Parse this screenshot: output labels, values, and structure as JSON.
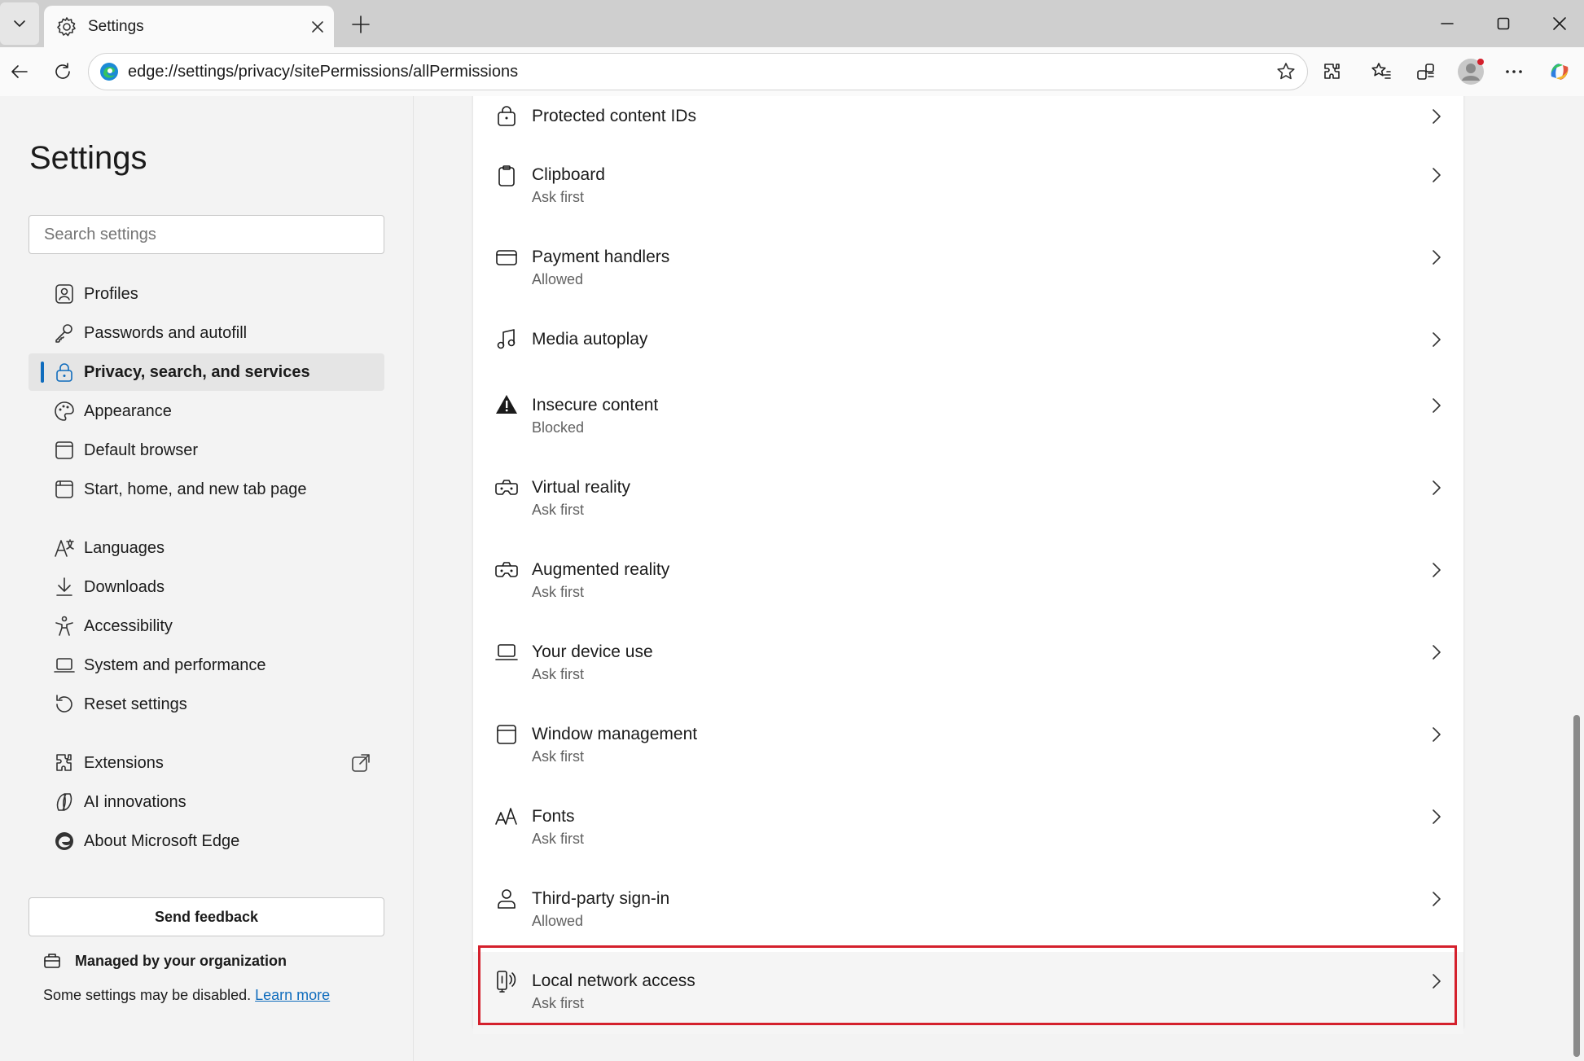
{
  "tab": {
    "title": "Settings"
  },
  "address": {
    "url": "edge://settings/privacy/sitePermissions/allPermissions"
  },
  "sidebar": {
    "title": "Settings",
    "search_placeholder": "Search settings",
    "items": [
      {
        "label": "Profiles",
        "icon": "profile-icon"
      },
      {
        "label": "Passwords and autofill",
        "icon": "key-icon"
      },
      {
        "label": "Privacy, search, and services",
        "icon": "lock-icon",
        "selected": true
      },
      {
        "label": "Appearance",
        "icon": "palette-icon"
      },
      {
        "label": "Default browser",
        "icon": "browser-icon"
      },
      {
        "label": "Start, home, and new tab page",
        "icon": "home-page-icon"
      },
      {
        "label": "Languages",
        "icon": "languages-icon"
      },
      {
        "label": "Downloads",
        "icon": "download-icon"
      },
      {
        "label": "Accessibility",
        "icon": "accessibility-icon"
      },
      {
        "label": "System and performance",
        "icon": "laptop-icon"
      },
      {
        "label": "Reset settings",
        "icon": "reset-icon"
      },
      {
        "label": "Extensions",
        "icon": "extensions-icon"
      },
      {
        "label": "AI innovations",
        "icon": "ai-innovations-icon"
      },
      {
        "label": "About Microsoft Edge",
        "icon": "edge-logo-icon"
      }
    ],
    "feedback_label": "Send feedback",
    "managed_label": "Managed by your organization",
    "managed_sub": "Some settings may be disabled. ",
    "learn_more": "Learn more"
  },
  "permissions": [
    {
      "label": "Protected content IDs",
      "sub": "",
      "icon": "protected-content-icon"
    },
    {
      "label": "Clipboard",
      "sub": "Ask first",
      "icon": "clipboard-icon"
    },
    {
      "label": "Payment handlers",
      "sub": "Allowed",
      "icon": "payment-card-icon"
    },
    {
      "label": "Media autoplay",
      "sub": "",
      "icon": "music-note-icon"
    },
    {
      "label": "Insecure content",
      "sub": "Blocked",
      "icon": "warning-icon"
    },
    {
      "label": "Virtual reality",
      "sub": "Ask first",
      "icon": "vr-headset-icon"
    },
    {
      "label": "Augmented reality",
      "sub": "Ask first",
      "icon": "ar-headset-icon"
    },
    {
      "label": "Your device use",
      "sub": "Ask first",
      "icon": "laptop-icon"
    },
    {
      "label": "Window management",
      "sub": "Ask first",
      "icon": "window-icon"
    },
    {
      "label": "Fonts",
      "sub": "Ask first",
      "icon": "fonts-icon"
    },
    {
      "label": "Third-party sign-in",
      "sub": "Allowed",
      "icon": "person-icon"
    },
    {
      "label": "Local network access",
      "sub": "Ask first",
      "icon": "local-network-icon",
      "highlighted": true
    }
  ],
  "colors": {
    "accent": "#0f6cbd",
    "highlight_border": "#d4202c"
  }
}
